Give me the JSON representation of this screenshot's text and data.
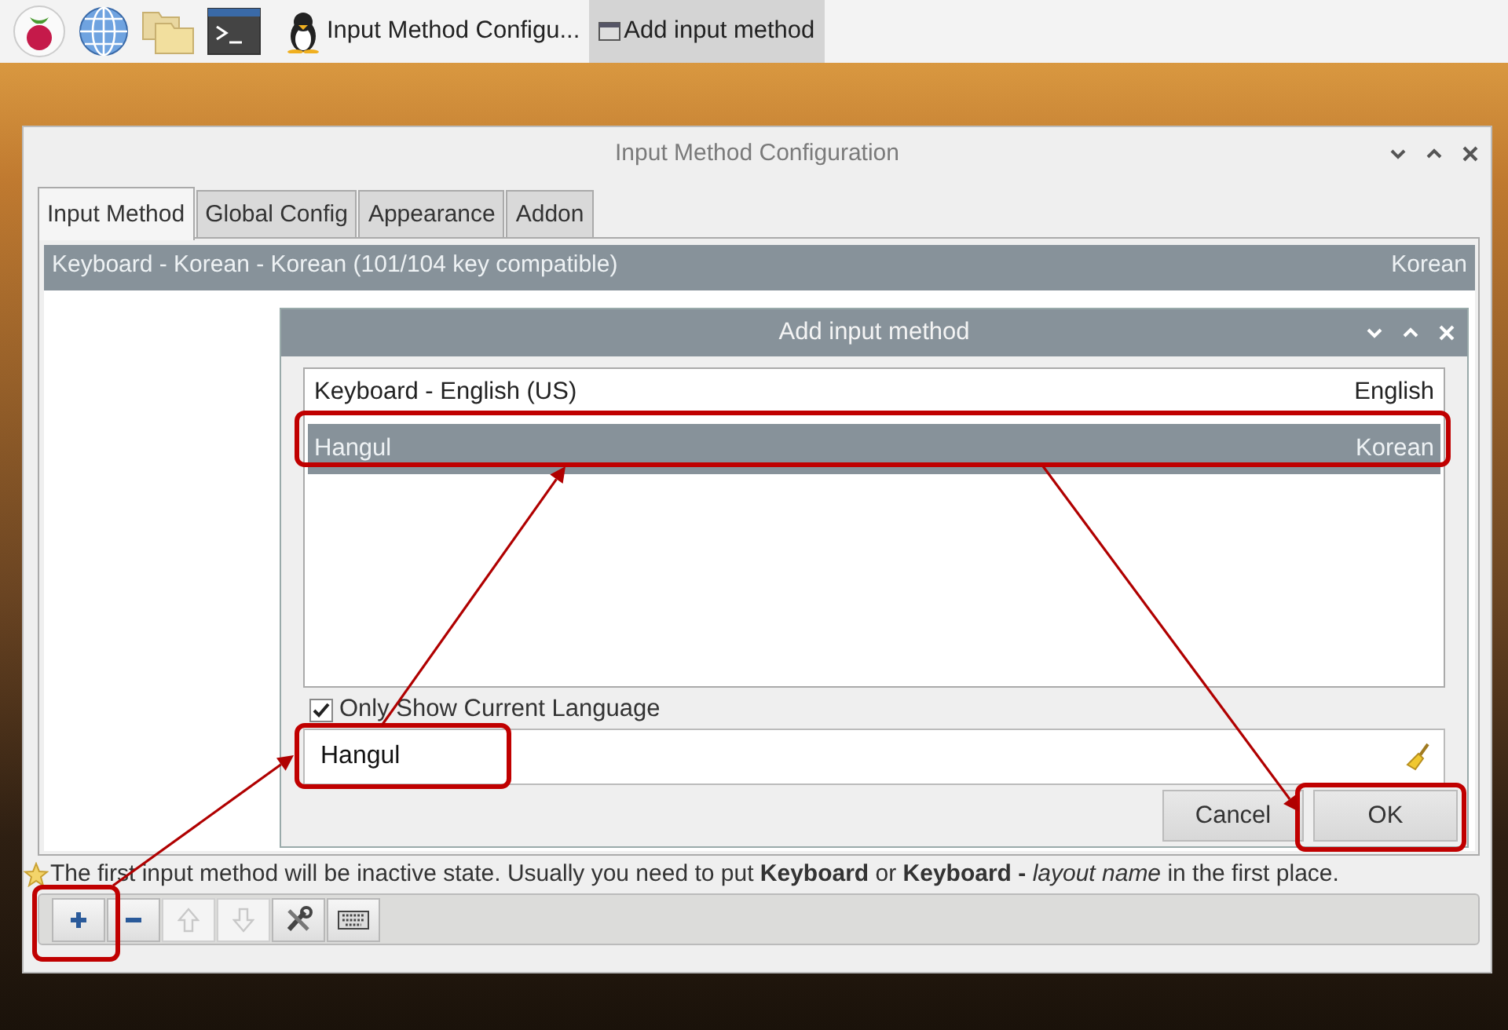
{
  "taskbar": {
    "tasks": [
      {
        "label": "Input Method Configu...",
        "kind": "penguin",
        "selected": false
      },
      {
        "label": "Add input method",
        "kind": "window",
        "selected": true
      }
    ]
  },
  "window": {
    "title": "Input Method Configuration"
  },
  "tabs": [
    {
      "label": "Input Method",
      "selected": true
    },
    {
      "label": "Global Config",
      "selected": false
    },
    {
      "label": "Appearance",
      "selected": false
    },
    {
      "label": "Addon",
      "selected": false
    }
  ],
  "input_methods": [
    {
      "name": "Keyboard - Korean - Korean (101/104 key compatible)",
      "language": "Korean",
      "selected": true
    }
  ],
  "dialog": {
    "title": "Add input method",
    "methods": [
      {
        "name": "Keyboard - English (US)",
        "language": "English",
        "selected": false
      },
      {
        "name": "Hangul",
        "language": "Korean",
        "selected": true
      }
    ],
    "only_show_current_language": {
      "label": "Only Show Current Language",
      "checked": true
    },
    "search": {
      "value": "Hangul"
    },
    "buttons": [
      {
        "label": "Cancel",
        "kind": "cancel"
      },
      {
        "label": "OK",
        "kind": "ok"
      }
    ]
  },
  "hint": "The first input method will be inactive state. Usually you need to put **Keyboard** or **Keyboard -** *layout name* in the first place.",
  "toolbar": [
    {
      "kind": "add",
      "disabled": false
    },
    {
      "kind": "remove",
      "disabled": false
    },
    {
      "kind": "up",
      "disabled": true
    },
    {
      "kind": "down",
      "disabled": true
    },
    {
      "kind": "configure",
      "disabled": false
    },
    {
      "kind": "keyboard",
      "disabled": false
    }
  ]
}
